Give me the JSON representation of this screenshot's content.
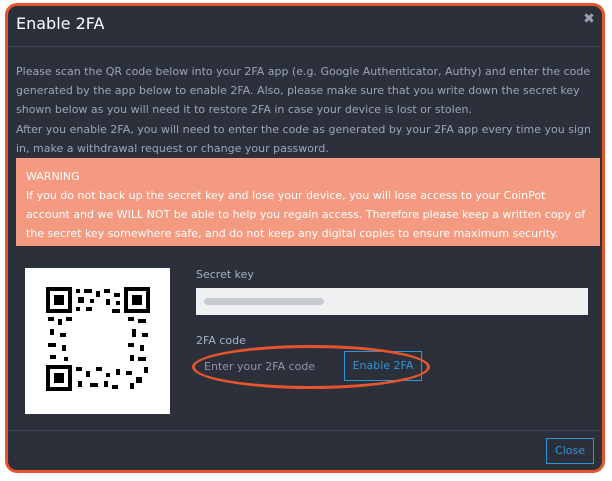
{
  "dialog": {
    "title": "Enable 2FA",
    "close_icon": "close-icon",
    "paragraph1": "Please scan the QR code below into your 2FA app (e.g. Google Authenticator, Authy) and enter the code generated by the app below to enable 2FA. Also, please make sure that you write down the secret key shown below as you will need it to restore 2FA in case your device is lost or stolen.",
    "paragraph2": "After you enable 2FA, you will need to enter the code as generated by your 2FA app every time you sign in, make a withdrawal request or change your password.",
    "warning": {
      "title": "WARNING",
      "text": "If you do not back up the secret key and lose your device, you will lose access to your CoinPot account and we WILL NOT be able to help you regain access. Therefore please keep a written copy of the secret key somewhere safe, and do not keep any digital copies to ensure maximum security."
    },
    "secret_key_label": "Secret key",
    "code_label": "2FA code",
    "code_placeholder": "Enter your 2FA code",
    "enable_button": "Enable 2FA",
    "close_button": "Close"
  },
  "colors": {
    "accent": "#2f96d6",
    "warning_bg": "#f49a80",
    "highlight": "#e8542c",
    "dialog_bg": "#2b303b"
  }
}
